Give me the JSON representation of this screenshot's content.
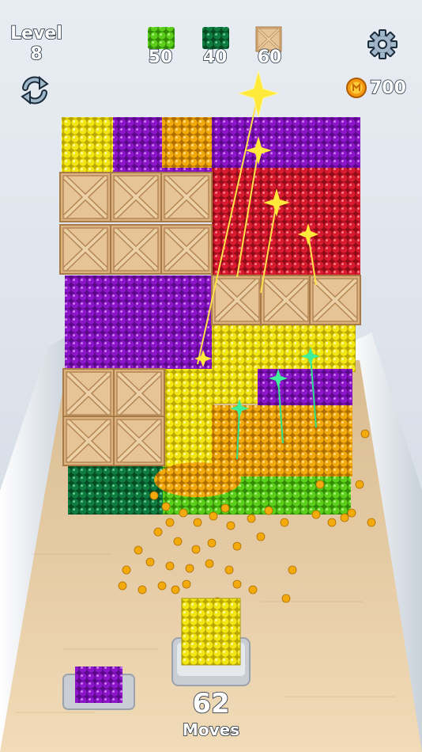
{
  "hud": {
    "level_label": "Level",
    "level_number": "8",
    "coins": "700",
    "moves_count": "62",
    "moves_label": "Moves"
  },
  "targets": [
    {
      "color": "#5fd01a",
      "count": "50",
      "kind": "green-balls"
    },
    {
      "color": "#0c7a4a",
      "count": "40",
      "kind": "darkgreen-balls"
    },
    {
      "color": "#d9a964",
      "count": "60",
      "kind": "crate"
    }
  ],
  "colors": {
    "yellow": "#f2e20a",
    "purple": "#8a14c6",
    "orange": "#f0a808",
    "red": "#d8182c",
    "darkgreen": "#0d7a3e",
    "lightgreen": "#58cc16",
    "wood": "#deb685",
    "track": "#e9cfa8"
  },
  "icons": [
    "gear-icon",
    "refresh-icon",
    "coin-icon"
  ]
}
